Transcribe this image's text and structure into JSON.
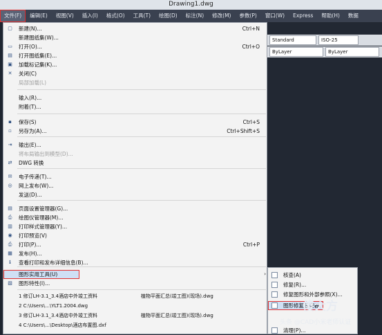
{
  "window": {
    "title": "Drawing1.dwg"
  },
  "menubar": [
    "文件(F)",
    "编辑(E)",
    "视图(V)",
    "插入(I)",
    "格式(O)",
    "工具(T)",
    "绘图(D)",
    "标注(N)",
    "修改(M)",
    "参数(P)",
    "窗口(W)",
    "Express",
    "帮助(H)",
    "数据"
  ],
  "toolbar": {
    "text_style": "Standard",
    "dim_style": "ISO-25",
    "layer1": "ByLayer",
    "layer2": "ByLayer"
  },
  "file_menu": [
    {
      "label": "新建(N)...",
      "shortcut": "Ctrl+N",
      "icon": "new-doc-icon"
    },
    {
      "label": "新建图纸集(W)...",
      "shortcut": "",
      "icon": ""
    },
    {
      "label": "打开(O)...",
      "shortcut": "Ctrl+O",
      "icon": "open-icon"
    },
    {
      "label": "打开图纸集(E)...",
      "shortcut": "",
      "icon": "open-sheet-icon"
    },
    {
      "label": "加载标记集(K)...",
      "shortcut": "",
      "icon": "markup-icon"
    },
    {
      "label": "关闭(C)",
      "shortcut": "",
      "icon": "close-doc-icon"
    },
    {
      "label": "局部加载(L)",
      "shortcut": "",
      "icon": "",
      "disabled": true
    },
    {
      "label": "输入(R)...",
      "shortcut": "",
      "icon": ""
    },
    {
      "label": "附着(T)...",
      "shortcut": "",
      "icon": ""
    },
    {
      "label": "保存(S)",
      "shortcut": "Ctrl+S",
      "icon": "save-icon"
    },
    {
      "label": "另存为(A)...",
      "shortcut": "Ctrl+Shift+S",
      "icon": "save-as-icon"
    },
    {
      "label": "输出(E)...",
      "shortcut": "",
      "icon": "export-icon"
    },
    {
      "label": "将布局输出到模型(D)...",
      "shortcut": "",
      "icon": "",
      "disabled": true
    },
    {
      "label": "DWG 转换",
      "shortcut": "",
      "icon": "dwg-convert-icon"
    },
    {
      "label": "电子传递(T)...",
      "shortcut": "",
      "icon": "etransmit-icon"
    },
    {
      "label": "网上发布(W)...",
      "shortcut": "",
      "icon": "web-publish-icon"
    },
    {
      "label": "发送(D)...",
      "shortcut": "",
      "icon": ""
    },
    {
      "label": "页面设置管理器(G)...",
      "shortcut": "",
      "icon": "page-setup-icon"
    },
    {
      "label": "绘图仪管理器(M)...",
      "shortcut": "",
      "icon": "plotter-icon"
    },
    {
      "label": "打印样式管理器(Y)...",
      "shortcut": "",
      "icon": "plot-style-icon"
    },
    {
      "label": "打印预览(V)",
      "shortcut": "",
      "icon": "preview-icon"
    },
    {
      "label": "打印(P)...",
      "shortcut": "Ctrl+P",
      "icon": "print-icon"
    },
    {
      "label": "发布(H)...",
      "shortcut": "",
      "icon": "publish-icon"
    },
    {
      "label": "查看打印和发布详细信息(B)...",
      "shortcut": "",
      "icon": "details-icon"
    },
    {
      "label": "图形实用工具(U)",
      "shortcut": "",
      "icon": "",
      "submenu": true
    },
    {
      "label": "图形特性(I)...",
      "shortcut": "",
      "icon": "properties-icon"
    }
  ],
  "recent_files": [
    {
      "name": "1 修订LH-3.1_3.4酒店中外竣工资料",
      "extra": "植物平面汇总(竣工图)(现场).dwg"
    },
    {
      "name": "2 C:\\Users\\...\\YLT1.2004.dwg",
      "extra": ""
    },
    {
      "name": "3 修订LH-3.1_3.4酒店中外竣工资料",
      "extra": "植物平面汇总(竣工图)(现场).dwg"
    },
    {
      "name": "4 C:\\Users\\...\\Desktop\\酒店布置图.dxf",
      "extra": ""
    }
  ],
  "submenu": [
    {
      "label": "核查(A)"
    },
    {
      "label": "修复(R)..."
    },
    {
      "label": "修复图形和外部参照(X)..."
    },
    {
      "label": "图形修复管理器"
    },
    {
      "label": "清理(P)..."
    }
  ],
  "watermark": {
    "main": "傻大方",
    "sub": "头条 @CAD小米老师认证"
  }
}
